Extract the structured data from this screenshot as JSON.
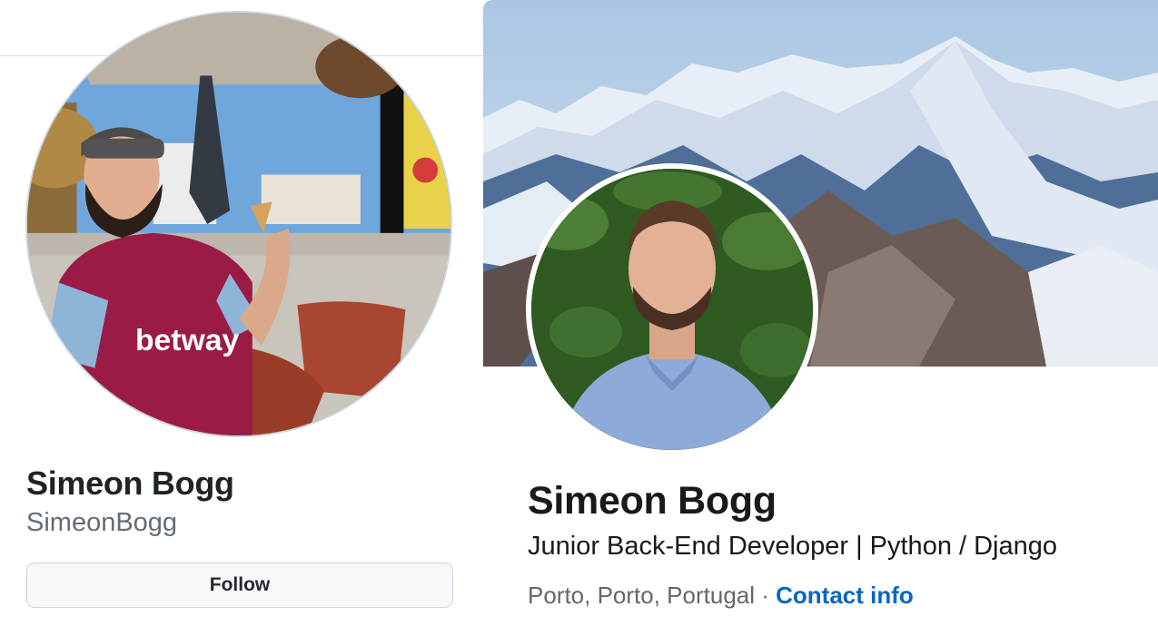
{
  "github": {
    "name": "Simeon Bogg",
    "username": "SimeonBogg",
    "follow_label": "Follow",
    "avatar_jersey_text": "betway"
  },
  "linkedin": {
    "name": "Simeon Bogg",
    "headline": "Junior Back-End Developer | Python / Django",
    "location": "Porto, Porto, Portugal",
    "separator": " · ",
    "contact_info_label": "Contact info"
  },
  "colors": {
    "link_blue": "#0a66c2",
    "button_bg": "#f6f8fa",
    "button_border": "#d0d7de",
    "muted_text": "#636c76",
    "jersey": "#9b1b47"
  }
}
